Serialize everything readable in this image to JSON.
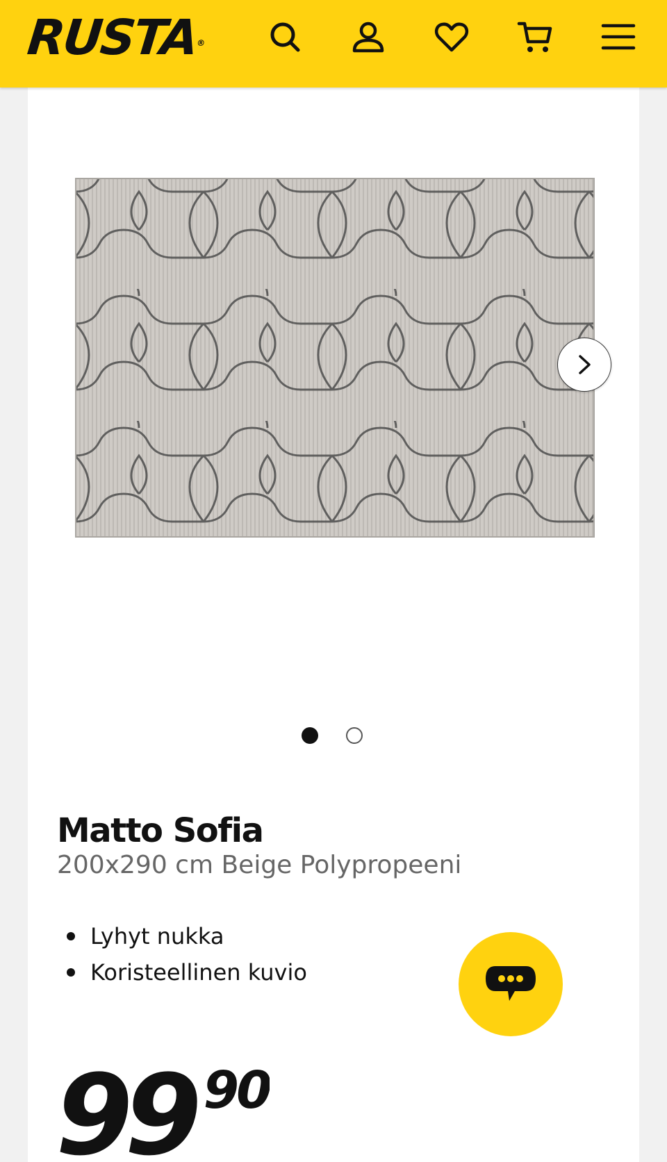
{
  "header": {
    "brand": "RUSTA",
    "brand_mark": "®",
    "background": "#ffd20f",
    "icons": [
      "search-icon",
      "account-icon",
      "heart-icon",
      "cart-icon",
      "menu-icon"
    ]
  },
  "gallery": {
    "image_alt": "Matto Sofia",
    "current_slide": 1,
    "total_slides": 2,
    "next_icon": "chevron-right-icon"
  },
  "product": {
    "name": "Matto Sofia",
    "details": "200x290 cm Beige Polypropeeni",
    "features": [
      "Lyhyt nukka",
      "Koristeellinen kuvio"
    ],
    "price_main": "99",
    "price_decimals": "90"
  },
  "chat": {
    "icon": "chat-bubble-icon",
    "color": "#ffd20f"
  }
}
